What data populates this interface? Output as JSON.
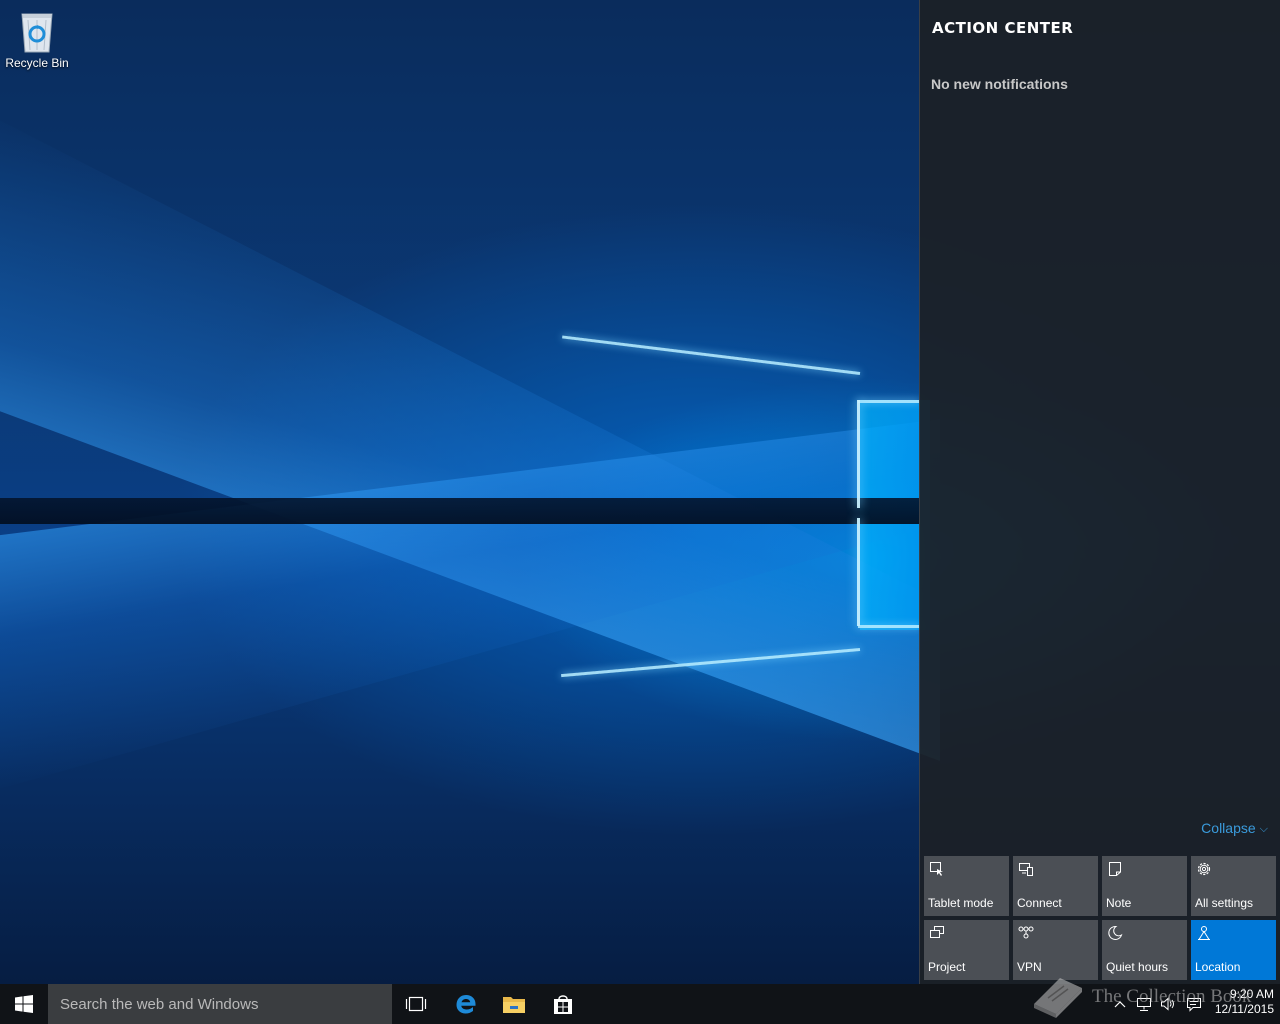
{
  "desktop": {
    "icons": [
      {
        "label": "Recycle Bin",
        "icon": "recycle-bin-icon"
      }
    ]
  },
  "action_center": {
    "title": "ACTION CENTER",
    "empty_message": "No new notifications",
    "collapse_label": "Collapse",
    "quick_actions": [
      {
        "label": "Tablet mode",
        "icon": "tablet-mode-icon",
        "active": false
      },
      {
        "label": "Connect",
        "icon": "connect-icon",
        "active": false
      },
      {
        "label": "Note",
        "icon": "note-icon",
        "active": false
      },
      {
        "label": "All settings",
        "icon": "gear-icon",
        "active": false
      },
      {
        "label": "Project",
        "icon": "project-icon",
        "active": false
      },
      {
        "label": "VPN",
        "icon": "vpn-icon",
        "active": false
      },
      {
        "label": "Quiet hours",
        "icon": "moon-icon",
        "active": false
      },
      {
        "label": "Location",
        "icon": "location-icon",
        "active": true
      }
    ],
    "colors": {
      "active_tile": "#0078d7",
      "tile": "#4b4f55",
      "link": "#3a9bdc"
    }
  },
  "taskbar": {
    "search_placeholder": "Search the web and Windows",
    "pinned": [
      {
        "name": "Task View",
        "icon": "task-view-icon"
      },
      {
        "name": "Microsoft Edge",
        "icon": "edge-icon"
      },
      {
        "name": "File Explorer",
        "icon": "folder-icon"
      },
      {
        "name": "Store",
        "icon": "store-icon"
      }
    ],
    "tray": {
      "icons": [
        "chevron-up-icon",
        "network-icon",
        "volume-icon",
        "action-center-icon"
      ],
      "time": "9:20 AM",
      "date": "12/11/2015"
    }
  },
  "watermark": {
    "text": "The Collection Book"
  }
}
